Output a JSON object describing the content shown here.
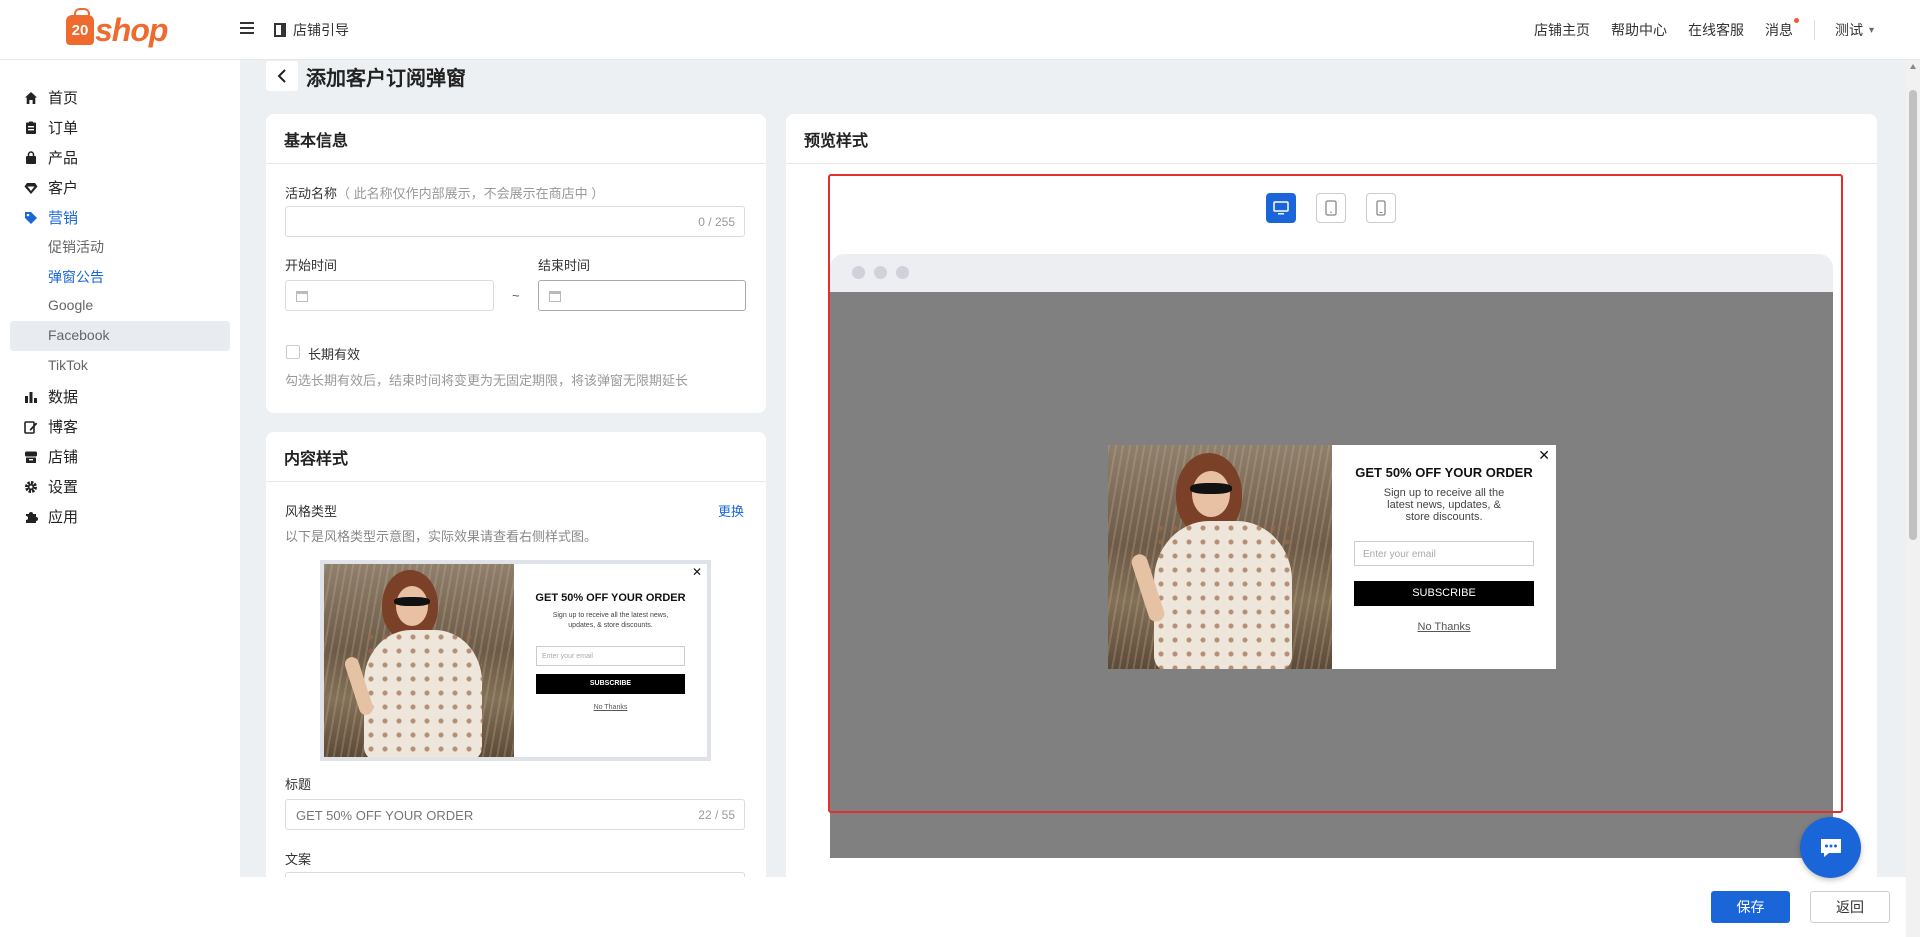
{
  "brand": {
    "logo_badge": "20",
    "logo_text": "shop",
    "accent": "#ef6a2e",
    "primary": "#1a66d8"
  },
  "topbar": {
    "guide": "店铺引导",
    "links": [
      "店铺主页",
      "帮助中心",
      "在线客服",
      "消息"
    ],
    "user": "测试"
  },
  "sidebar": {
    "items": [
      {
        "label": "首页",
        "icon": "home-icon"
      },
      {
        "label": "订单",
        "icon": "order-icon"
      },
      {
        "label": "产品",
        "icon": "bag-icon"
      },
      {
        "label": "客户",
        "icon": "diamond-icon"
      },
      {
        "label": "营销",
        "icon": "tag-icon"
      },
      {
        "label": "数据",
        "icon": "chart-icon"
      },
      {
        "label": "博客",
        "icon": "edit-icon"
      },
      {
        "label": "店铺",
        "icon": "store-icon"
      },
      {
        "label": "设置",
        "icon": "gear-icon"
      },
      {
        "label": "应用",
        "icon": "puzzle-icon"
      }
    ],
    "submenu": [
      "促销活动",
      "弹窗公告",
      "Google",
      "Facebook",
      "TikTok"
    ]
  },
  "page": {
    "title": "添加客户订阅弹窗"
  },
  "basic": {
    "header": "基本信息",
    "name_label": "活动名称",
    "name_hint": "（ 此名称仅作内部展示，不会展示在商店中 ）",
    "name_count": "0 / 255",
    "start_label": "开始时间",
    "end_label": "结束时间",
    "tilde": "~",
    "longterm_label": "长期有效",
    "longterm_hint": "勾选长期有效后，结束时间将变更为无固定期限，将该弹窗无限期延长"
  },
  "content": {
    "header": "内容样式",
    "style_label": "风格类型",
    "change": "更换",
    "style_hint": "以下是风格类型示意图，实际效果请查看右侧样式图。",
    "title_label": "标题",
    "title_value": "GET 50% OFF YOUR ORDER",
    "title_count": "22 / 55",
    "copy_label": "文案"
  },
  "popup": {
    "close": "✕",
    "title": "GET 50% OFF YOUR ORDER",
    "subtitle": "Sign up to receive all the latest news, updates, & store discounts.",
    "email_placeholder": "Enter your email",
    "button": "SUBSCRIBE",
    "no_thanks": "No Thanks"
  },
  "preview": {
    "header": "预览样式",
    "devices": [
      "desktop-icon",
      "tablet-icon",
      "mobile-icon"
    ],
    "active_device": "desktop-icon"
  },
  "footer": {
    "save": "保存",
    "back": "返回"
  }
}
